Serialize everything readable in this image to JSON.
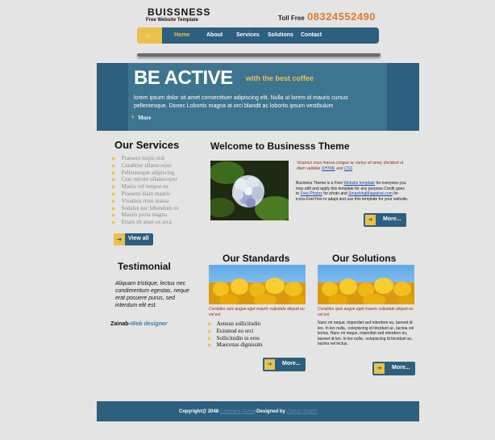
{
  "header": {
    "logo_title": "BUISSNESS",
    "logo_subtitle": "Free Website Template",
    "toll_label": "Toll Free",
    "toll_number": "08324552490"
  },
  "nav": {
    "home_icon": "home-icon",
    "items": [
      "Home",
      "About",
      "Services",
      "Solutions",
      "Contact"
    ]
  },
  "banner": {
    "title": "BE ACTIVE",
    "tagline": "with the best coffee",
    "text": "lorem ipsum dolor sit amet consectituer adipiscing elit. Nulla ut lorem id mauris cursus pellentesque. Donec Lobortis magna at orci blandit ac lobortis ipsum vestibulum",
    "more_label": "More"
  },
  "services": {
    "title": "Our Services",
    "items": [
      "Praesent turpis erat",
      "Curabitur ullamcorper",
      "Pellentesque adipiscing",
      "Cras rutrum ullamcorper",
      "Mattis vel tempor eu",
      "Praesent diam mauris",
      "Vivamus risus massa",
      "Sodales nec bibendum ev",
      "Mauris porta magna",
      "Etiam sit amet ex arca"
    ],
    "button_label": "View all"
  },
  "testimonial": {
    "title": "Testimonial",
    "quote": "Aliquam tristique, lectus nec condimentum egestas, neque erat posuere purus, sed interdum elit est.",
    "author_name": "Zainab-",
    "author_role": "Web designer"
  },
  "welcome": {
    "title": "Welcome to Businesss Theme",
    "italic_text": "Vivamus risus massa congue ac varius sit amet, tincidunt ut diam validate",
    "xhtml_link": "XHTML",
    "and_word": "and",
    "css_link": "CSS",
    "body_1": "Business Theme is a Free",
    "body_link1": "Website template",
    "body_2": "for everyone.you may edit and apply this template for any purpose.Credit goes to",
    "body_link2": "Free Photos",
    "body_3": "for photo and",
    "body_link3": "SmashingMagazine.com",
    "body_4": "for icons.Feel free to adapt and use this template for your website.",
    "button_label": "More..."
  },
  "standards": {
    "title": "Our Standards",
    "caption": "Curabitur quis augue eget mauris vulputate aliquet eu vel est",
    "items": [
      "Aenean sollicitudin",
      "Euismod eu orci",
      "Sollicitudin in eros",
      "Maecenas dignissim"
    ],
    "button_label": "More..."
  },
  "solutions": {
    "title": "Our Solutions",
    "caption": "Curabitur quis augue eget mauris vulputate aliquet eu vel est",
    "text": "Nunc mi neque, imperdiet sed interdem eu, laoreet id leo. In leo nulla, -sclepiscing id tincidunt ac, lacinia vel lectus. Nunc mi neque, imperdiet sed interdem eu, laoreet id leo. In leo nulla, -sclepiscing id tincidunt ac, lacinia vel lectus.",
    "button_label": "More..."
  },
  "footer": {
    "copyright": "Copyright@ 2048",
    "company_link": "Company Name",
    "designed_by": "-Designed by",
    "designer_link": "Zainab Shaikh"
  },
  "colors": {
    "primary": "#2d5f7e",
    "accent": "#ecc14b",
    "phone": "#e07b2c"
  }
}
